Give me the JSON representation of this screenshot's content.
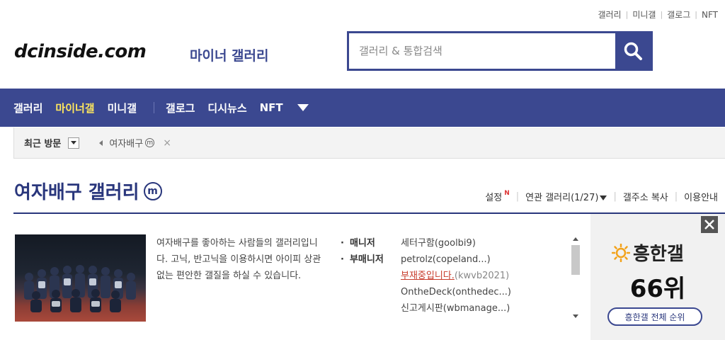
{
  "top_links": [
    "갤러리",
    "미니갤",
    "갤로그",
    "NFT"
  ],
  "logo": {
    "text": "dcinside.com",
    "subtitle": "마이너 갤러리"
  },
  "search": {
    "placeholder": "갤러리 & 통합검색",
    "value": ""
  },
  "nav": {
    "items": [
      "갤러리",
      "마이너갤",
      "미니갤",
      "갤로그",
      "디시뉴스",
      "NFT"
    ],
    "active": "마이너갤"
  },
  "recent": {
    "label": "최근 방문",
    "gallery": "여자배구",
    "mark": "ⓜ",
    "close": "×"
  },
  "gallery": {
    "title": "여자배구 갤러리",
    "badge": "m",
    "links": {
      "settings": "설정",
      "new_badge": "N",
      "related": "연관 갤러리(1/27)",
      "copy": "갤주소 복사",
      "info": "이용안내"
    },
    "description": "여자배구를 좋아하는 사람들의 갤러리입니다. 고닉, 반고닉을 이용하시면 아이피 상관없는 편안한 갤질을 하실 수 있습니다.",
    "roles": [
      "매니저",
      "부매니저"
    ],
    "managers": [
      {
        "name": "세터구함(goolbi9)"
      },
      {
        "name": "petrolz(copeland...)"
      },
      {
        "status": "부재중입니다.",
        "id": "(kwvb2021)"
      },
      {
        "name": "OntheDeck(onthedec...)"
      },
      {
        "name": "신고게시판(wbmanage...)"
      }
    ]
  },
  "ranking": {
    "title": "흥한갤",
    "rank": "66위",
    "button": "흥한갤 전체 순위"
  },
  "colors": {
    "brand": "#3b4890",
    "title": "#29367c",
    "active_nav": "#ffe75e",
    "absent": "#c73a2a"
  }
}
